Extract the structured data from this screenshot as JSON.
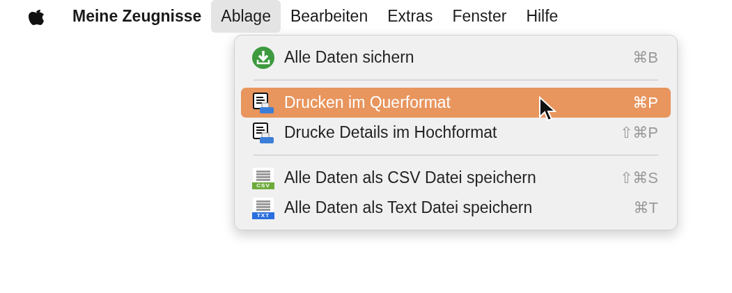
{
  "menu_bar": {
    "app_name": "Meine Zeugnisse",
    "menus": [
      {
        "label": "Ablage",
        "selected": true
      },
      {
        "label": "Bearbeiten",
        "selected": false
      },
      {
        "label": "Extras",
        "selected": false
      },
      {
        "label": "Fenster",
        "selected": false
      },
      {
        "label": "Hilfe",
        "selected": false
      }
    ]
  },
  "dropdown": {
    "items": [
      {
        "kind": "download",
        "label": "Alle Daten sichern",
        "shortcut": "⌘B",
        "selected": false
      },
      {
        "kind": "separator"
      },
      {
        "kind": "print",
        "label": "Drucken im Querformat",
        "shortcut": "⌘P",
        "selected": true
      },
      {
        "kind": "print",
        "label": "Drucke Details im Hochformat",
        "shortcut": "⇧⌘P",
        "selected": false
      },
      {
        "kind": "separator"
      },
      {
        "kind": "export",
        "badge": "CSV",
        "color": "#6eab3c",
        "label": "Alle Daten als CSV Datei speichern",
        "shortcut": "⇧⌘S",
        "selected": false
      },
      {
        "kind": "export",
        "badge": "TXT",
        "color": "#2a6ee0",
        "label": "Alle Daten als Text Datei speichern",
        "shortcut": "⌘T",
        "selected": false
      }
    ]
  }
}
